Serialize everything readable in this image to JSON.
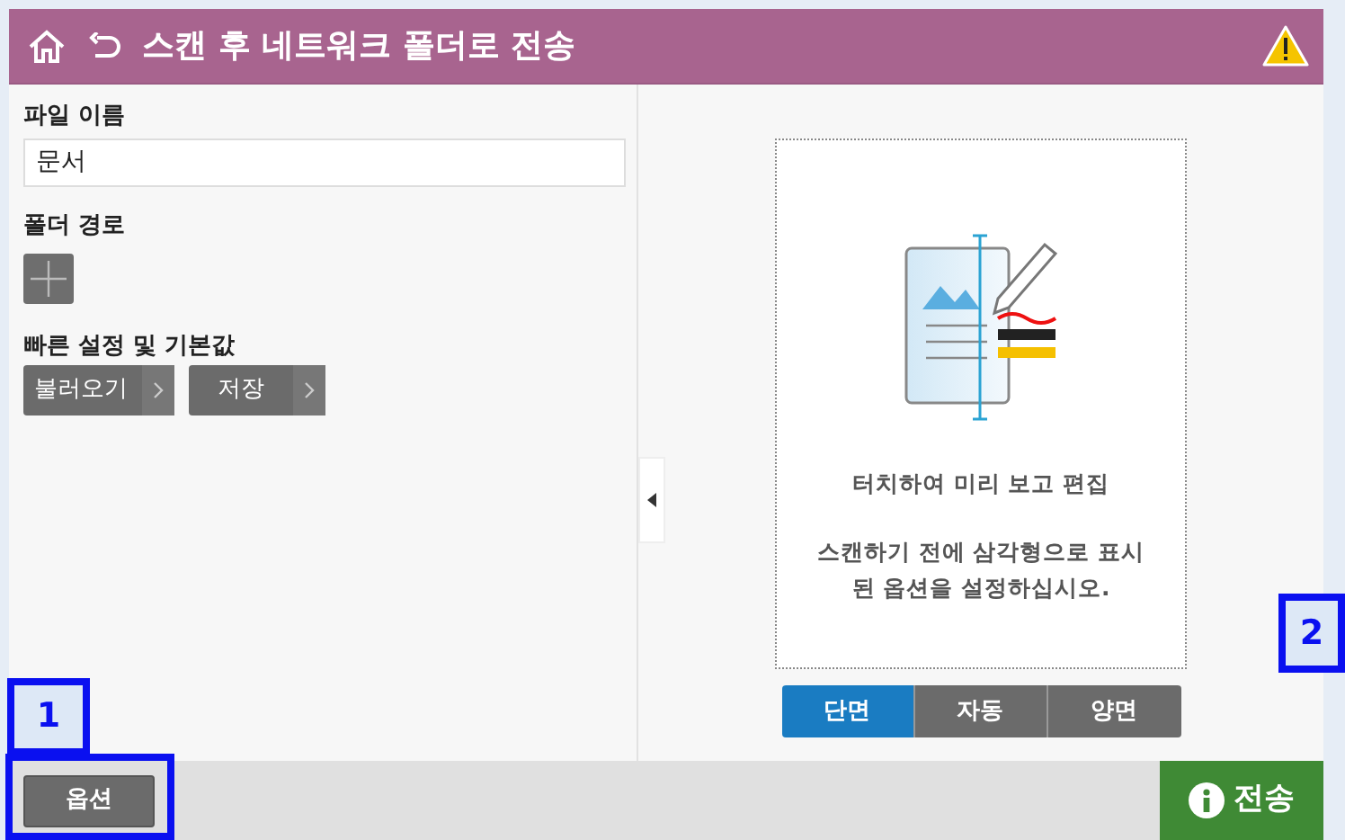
{
  "header": {
    "title": "스캔 후 네트워크 폴더로 전송",
    "warning": true
  },
  "left_panel": {
    "file_name": {
      "label": "파일 이름",
      "value": "문서"
    },
    "folder_path": {
      "label": "폴더 경로"
    },
    "quick_settings": {
      "label": "빠른 설정 및 기본값",
      "buttons": [
        "불러오기",
        "저장"
      ]
    }
  },
  "preview": {
    "title": "터치하여 미리 보고 편집",
    "hint": "스캔하기 전에 삼각형으로 표시된 옵션을 설정하십시오.",
    "sides": [
      {
        "label": "단면",
        "selected": true
      },
      {
        "label": "자동",
        "selected": false
      },
      {
        "label": "양면",
        "selected": false
      }
    ]
  },
  "footer": {
    "options_button": "옵션",
    "send_button": "전송"
  },
  "callouts": [
    "1",
    "2"
  ]
}
